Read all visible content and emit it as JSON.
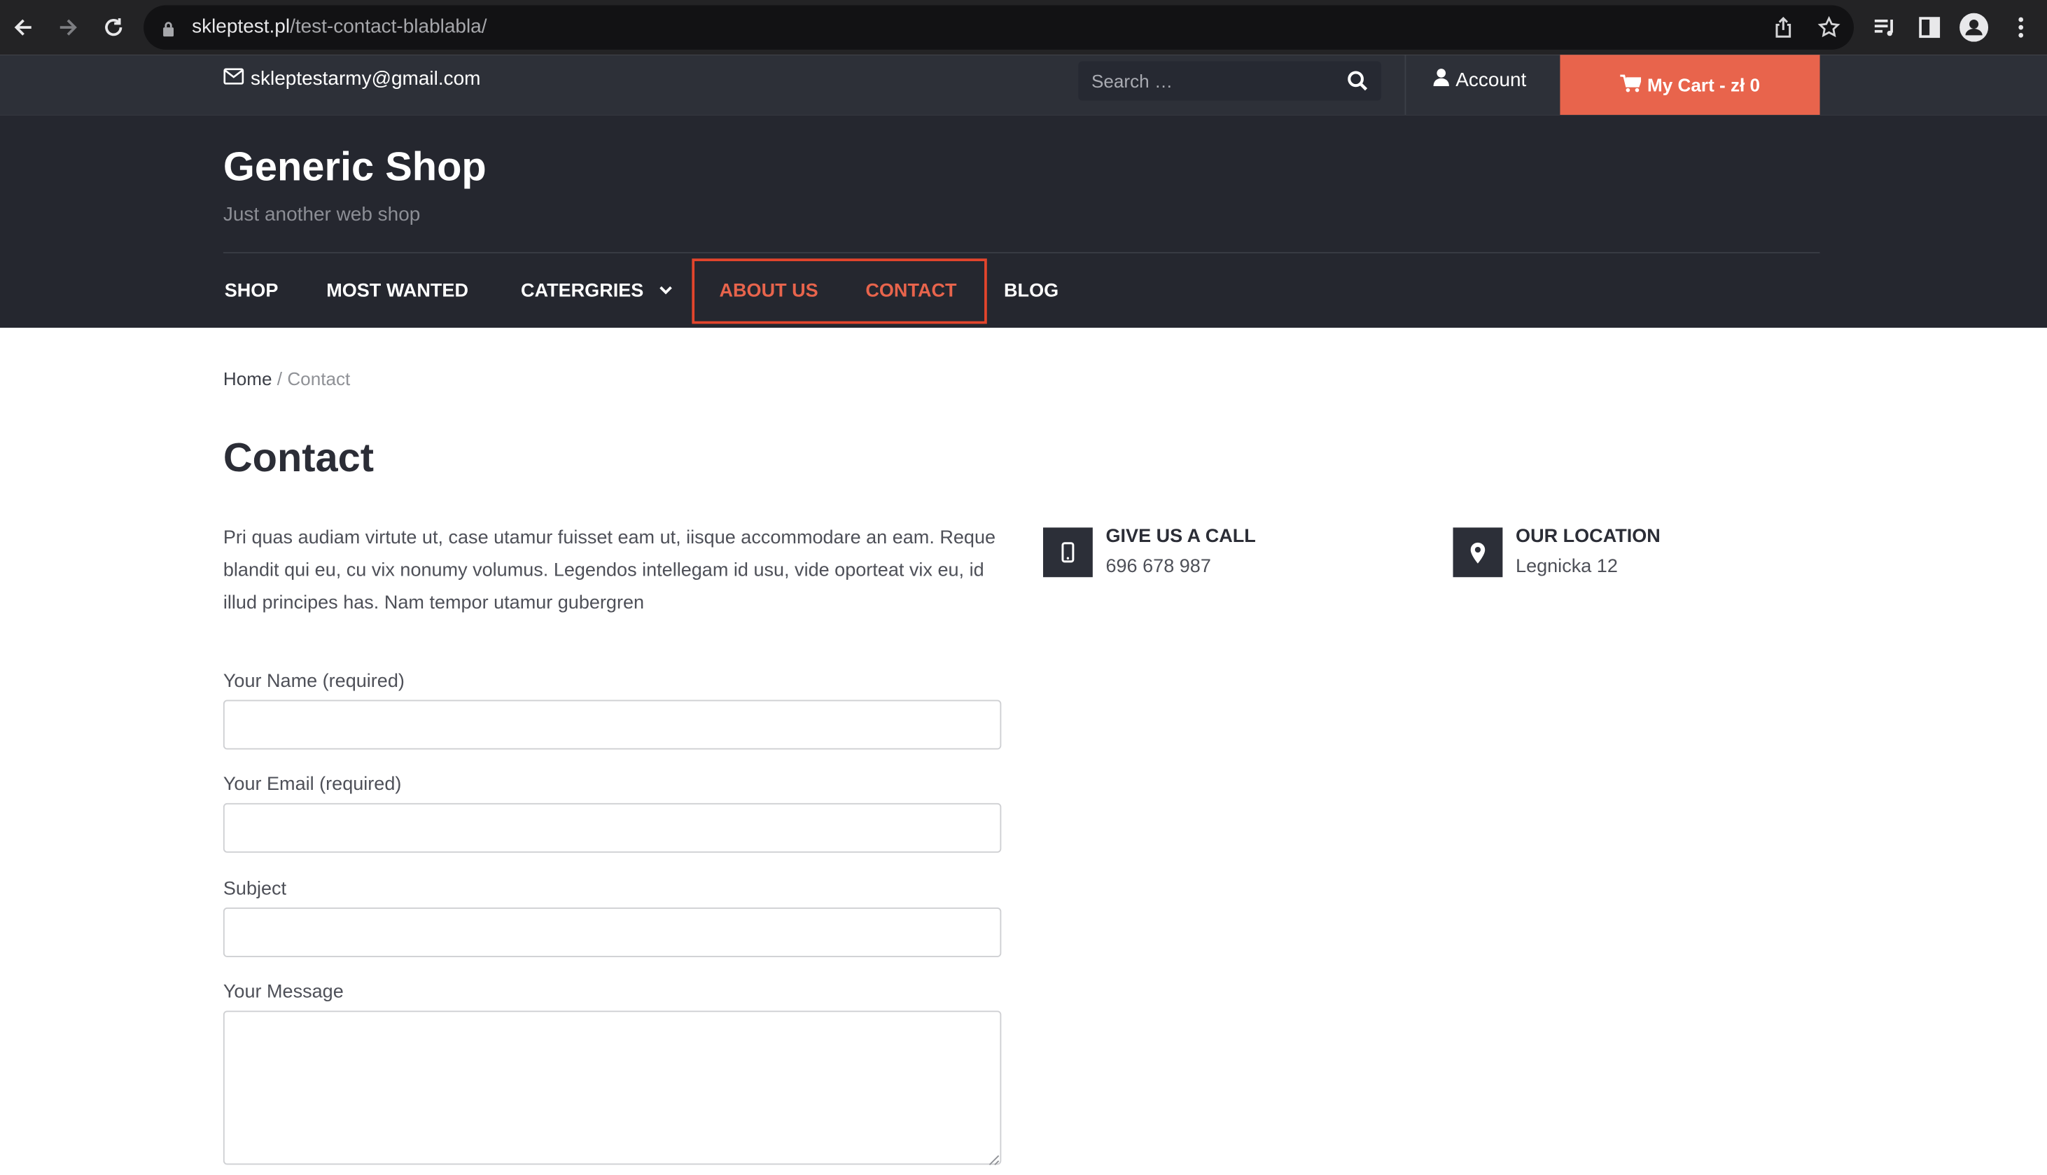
{
  "browser": {
    "url_domain": "skleptest.pl",
    "url_path": "/test-contact-blablabla/"
  },
  "topbar": {
    "email": "skleptestarmy@gmail.com",
    "search_placeholder": "Search …",
    "account_label": "Account",
    "cart_label": "My Cart - zł 0"
  },
  "header": {
    "site_title": "Generic Shop",
    "tagline": "Just another web shop"
  },
  "menu": {
    "items": [
      {
        "label": "SHOP"
      },
      {
        "label": "MOST WANTED"
      },
      {
        "label": "CATERGRIES"
      },
      {
        "label": "ABOUT US"
      },
      {
        "label": "CONTACT"
      },
      {
        "label": "BLOG"
      }
    ]
  },
  "breadcrumb": {
    "home": "Home",
    "separator": "/",
    "current": "Contact"
  },
  "page": {
    "title": "Contact",
    "intro": "Pri quas audiam virtute ut, case utamur fuisset eam ut, iisque accommodare an eam. Reque blandit qui eu, cu vix nonumy volumus. Legendos intellegam id usu, vide oporteat vix eu, id illud principes has. Nam tempor utamur gubergren"
  },
  "form": {
    "name_label": "Your Name (required)",
    "email_label": "Your Email (required)",
    "subject_label": "Subject",
    "message_label": "Your Message"
  },
  "info": {
    "call_title": "GIVE US A CALL",
    "call_value": "696 678 987",
    "location_title": "OUR LOCATION",
    "location_value": "Legnicka 12"
  },
  "colors": {
    "accent": "#e8644c",
    "header_bg": "#25272f",
    "topbar_bg": "#2d3038",
    "highlight_border": "#e3452c"
  }
}
